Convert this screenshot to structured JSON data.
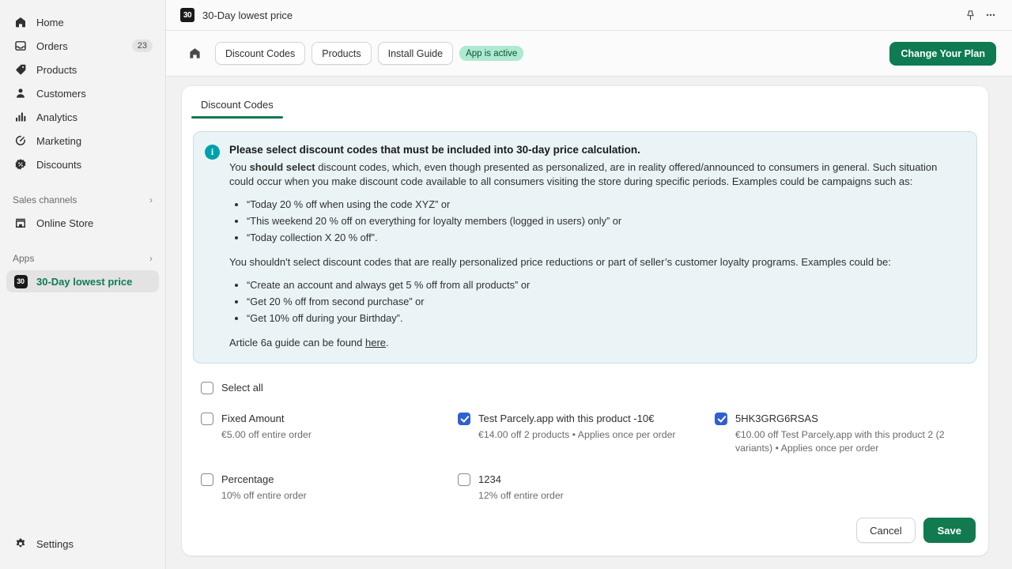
{
  "sidebar": {
    "items": [
      {
        "label": "Home",
        "icon": "home-icon",
        "badge": ""
      },
      {
        "label": "Orders",
        "icon": "orders-icon",
        "badge": "23"
      },
      {
        "label": "Products",
        "icon": "products-tag-icon",
        "badge": ""
      },
      {
        "label": "Customers",
        "icon": "customers-person-icon",
        "badge": ""
      },
      {
        "label": "Analytics",
        "icon": "analytics-bars-icon",
        "badge": ""
      },
      {
        "label": "Marketing",
        "icon": "marketing-target-icon",
        "badge": ""
      },
      {
        "label": "Discounts",
        "icon": "discounts-percent-icon",
        "badge": ""
      }
    ],
    "sales_channels_label": "Sales channels",
    "online_store_label": "Online Store",
    "apps_label": "Apps",
    "app_item_label": "30-Day lowest price",
    "app_item_icon_text": "30",
    "settings_label": "Settings"
  },
  "topbar": {
    "app_icon_text": "30",
    "title": "30-Day lowest price",
    "pin_icon": "pin-icon",
    "more_icon": "ellipsis-icon"
  },
  "appbar": {
    "home_icon": "home-icon",
    "nav": [
      "Discount Codes",
      "Products",
      "Install Guide"
    ],
    "status": "App is active",
    "primary_button": "Change Your Plan"
  },
  "card": {
    "tabs": [
      {
        "label": "Discount Codes",
        "active": true
      }
    ]
  },
  "banner": {
    "icon": "info-icon",
    "heading": "Please select discount codes that must be included into 30-day price calculation.",
    "para1_prefix": "You ",
    "para1_bold": "should select",
    "para1_rest": " discount codes, which, even though presented as personalized, are in reality offered/announced to consumers in general. Such situation could occur when you make discount code available to all consumers visiting the store during specific periods. Examples could be campaigns such as:",
    "list1": [
      "“Today 20 % off when using the code XYZ” or",
      "“This weekend 20 % off on everything for loyalty members (logged in users) only” or",
      "“Today collection X 20 % off”."
    ],
    "para2": "You shouldn't select discount codes that are really personalized price reductions or part of seller’s customer loyalty programs. Examples could be:",
    "list2": [
      "“Create an account and always get 5 % off from all products” or",
      "“Get 20 % off from second purchase” or",
      "“Get 10% off during your Birthday”."
    ],
    "para3_prefix": "Article 6a guide can be found ",
    "para3_link": "here",
    "para3_suffix": "."
  },
  "checkboxes": {
    "select_all_label": "Select all",
    "select_all_checked": false,
    "items": [
      {
        "label": "Fixed Amount",
        "sub": "€5.00 off entire order",
        "checked": false
      },
      {
        "label": "Test Parcely.app with this product -10€",
        "sub": "€14.00 off 2 products • Applies once per order",
        "checked": true
      },
      {
        "label": "5HK3GRG6RSAS",
        "sub": "€10.00 off Test Parcely.app with this product 2 (2 variants) • Applies once per order",
        "checked": true
      },
      {
        "label": "Percentage",
        "sub": "10% off entire order",
        "checked": false
      },
      {
        "label": "1234",
        "sub": "12% off entire order",
        "checked": false
      }
    ]
  },
  "footer": {
    "cancel_label": "Cancel",
    "save_label": "Save"
  },
  "colors": {
    "accent_green": "#117a4f",
    "checkbox_blue": "#2f5fd0",
    "banner_bg": "#eaf4f7",
    "banner_border": "#c3dfe6",
    "info_teal": "#00a0ac",
    "badge_green_bg": "#aee9d1",
    "badge_green_text": "#0c5132"
  }
}
